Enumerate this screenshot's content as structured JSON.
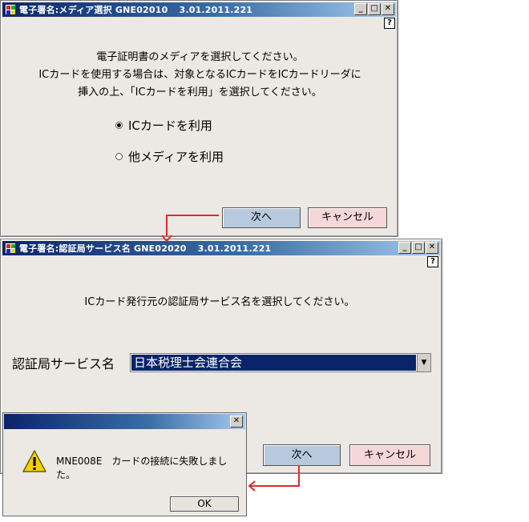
{
  "window1": {
    "title": "電子署名:メディア選択 GNE02010",
    "version": "3.01.2011.221",
    "help": "?",
    "lines": [
      "電子証明書のメディアを選択してください。",
      "ICカードを使用する場合は、対象となるICカードをICカードリーダに",
      "挿入の上、「ICカードを利用」を選択してください。"
    ],
    "options": [
      "ICカードを利用",
      "他メディアを利用"
    ],
    "selected_option": "ICカードを利用",
    "next_label": "次へ",
    "cancel_label": "キャンセル"
  },
  "window2": {
    "title": "電子署名:認証局サービス名 GNE02020",
    "version": "3.01.2011.221",
    "help": "?",
    "instruction": "ICカード発行元の認証局サービス名を選択してください。",
    "service_label": "認証局サービス名",
    "service_value": "日本税理士会連合会",
    "next_label": "次へ",
    "cancel_label": "キャンセル"
  },
  "dialog": {
    "message": "MNE008E　カードの接続に失敗しました。",
    "ok_label": "OK"
  },
  "caption": {
    "minimize": "_",
    "maximize": "□",
    "close": "✕"
  },
  "colors": {
    "arrow": "#e0282b",
    "next_button": "#b7c9dc",
    "cancel_button": "#f5d7d7",
    "selection": "#0a246a"
  },
  "icons": [
    "app-icon",
    "help-icon",
    "warning-icon",
    "close-icon",
    "minimize-icon",
    "maximize-icon"
  ]
}
